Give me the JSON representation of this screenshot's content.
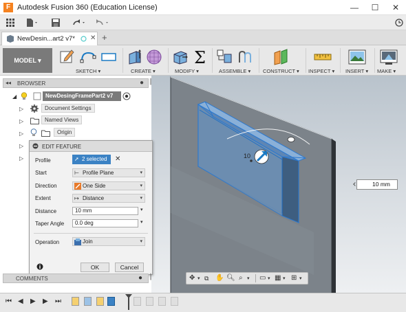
{
  "window": {
    "app_icon": "F",
    "title": "Autodesk Fusion 360 (Education License)",
    "minimize": "—",
    "maximize": "☐",
    "close": "✕"
  },
  "tab": {
    "label": "NewDesin...art2 v7*"
  },
  "toolbar": {
    "workspace": "MODEL ▾",
    "groups": [
      {
        "label": "SKETCH ▾"
      },
      {
        "label": "CREATE ▾"
      },
      {
        "label": "MODIFY ▾"
      },
      {
        "label": "ASSEMBLE ▾"
      },
      {
        "label": "CONSTRUCT ▾"
      },
      {
        "label": "INSPECT ▾"
      },
      {
        "label": "INSERT ▾"
      },
      {
        "label": "MAKE ▾"
      }
    ],
    "colors": {
      "construct_orange": "#f0a050",
      "construct_green": "#5cb85c",
      "workspace_bg": "#7a7a7a"
    }
  },
  "browser": {
    "title": "BROWSER",
    "root": "NewDesingFramePart2 v7",
    "items": [
      {
        "label": "Document Settings"
      },
      {
        "label": "Named Views"
      },
      {
        "label": "Origin"
      }
    ]
  },
  "dialog": {
    "title": "EDIT FEATURE",
    "profile_label": "Profile",
    "profile_value": "2 selected",
    "start_label": "Start",
    "start_value": "Profile Plane",
    "direction_label": "Direction",
    "direction_value": "One Side",
    "extent_label": "Extent",
    "extent_value": "Distance",
    "distance_label": "Distance",
    "distance_value": "10 mm",
    "taper_label": "Taper Angle",
    "taper_value": "0.0 deg",
    "operation_label": "Operation",
    "operation_value": "Join",
    "ok": "OK",
    "cancel": "Cancel"
  },
  "viewport": {
    "dimension_label": "10",
    "distance_box": "10 mm"
  },
  "comments": {
    "title": "COMMENTS"
  }
}
